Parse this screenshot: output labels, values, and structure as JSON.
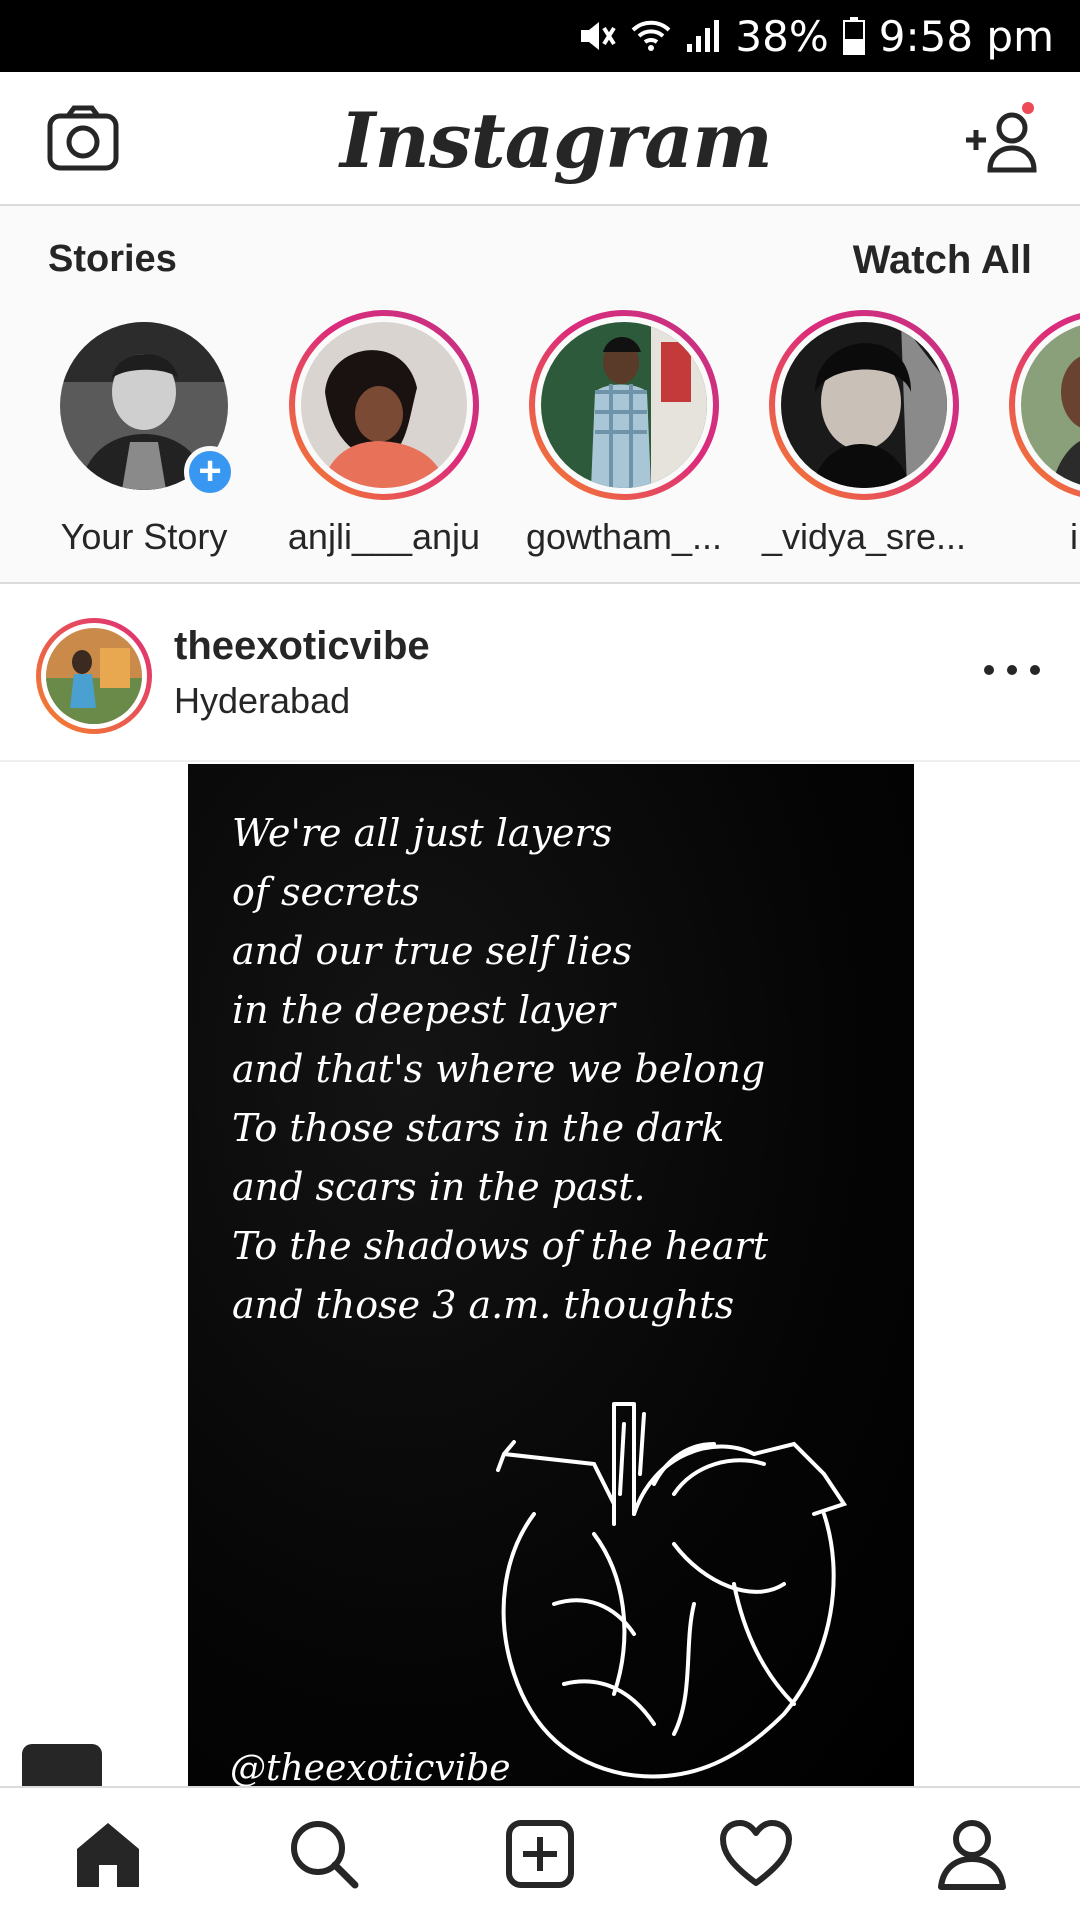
{
  "status_bar": {
    "battery": "38%",
    "time": "9:58 pm",
    "icons": [
      "mute-vibrate-icon",
      "wifi-icon",
      "signal-icon",
      "battery-icon"
    ]
  },
  "app_bar": {
    "logo_text": "Instagram",
    "icons": [
      "camera-icon",
      "add-user-icon"
    ],
    "notification_color": "#ed4956"
  },
  "stories": {
    "title": "Stories",
    "watch_all": "Watch All",
    "items": [
      {
        "label": "Your Story"
      },
      {
        "label": "anjli___anju"
      },
      {
        "label": "gowtham_..."
      },
      {
        "label": "_vidya_sre..."
      },
      {
        "label": "indh"
      }
    ],
    "ring_colors": [
      "#f58529",
      "#dd2a7b",
      "#c13584"
    ],
    "add_badge_color": "#3897f0"
  },
  "post": {
    "username": "theexoticvibe",
    "location": "Hyderabad",
    "quote": "We're all just layers\nof secrets\nand our true self lies\nin the deepest layer\nand that's where we belong\nTo those stars in the dark\nand scars in the past.\nTo the shadows of the heart\nand those 3 a.m. thoughts",
    "watermark": "@theexoticvibe"
  },
  "bottom_nav": {
    "items": [
      "home-icon",
      "search-icon",
      "new-post-icon",
      "activity-heart-icon",
      "profile-icon"
    ]
  }
}
